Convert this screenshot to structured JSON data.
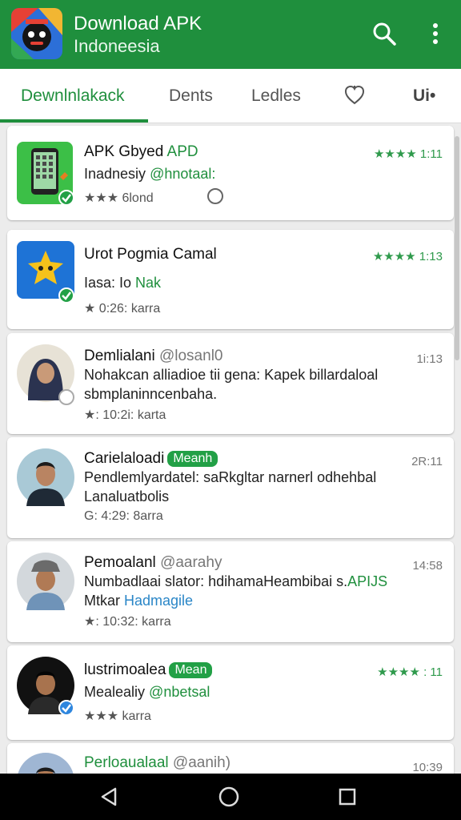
{
  "app": {
    "title": "Download APK",
    "subtitle": "Indoneesia"
  },
  "tabs": [
    {
      "label": "Dewnlnlakack"
    },
    {
      "label": "Dents"
    },
    {
      "label": "Ledles"
    },
    {
      "label": "heart-icon"
    },
    {
      "label": "Ui•"
    }
  ],
  "items": [
    {
      "title": "APK Gbyed ",
      "title_accent": "APD",
      "right": "★★★★ 1:11",
      "line2": "Inadnesiy ",
      "line2_accent": "@hnotaal:",
      "meta": "★★★ 6lond"
    },
    {
      "title": "Urot Pogmia Camal",
      "right": "★★★★ 1:13",
      "line2": "Iasa: Io ",
      "line2_accent": "Nak",
      "meta": "★ 0:26: karra"
    },
    {
      "title": "Demlialani ",
      "title_muted": "@losanl0",
      "right": "1i:13",
      "line2": "Nohakcan alliadioe tii gena: Kapek billardaloal",
      "line3": "sbmplaninncenbaha.",
      "meta": "★: 10:2i: karta"
    },
    {
      "title": "Carielaloadi",
      "badge": "Meanh",
      "right": "2R:11",
      "line2": "Pendlemlyardatel: saRkgltar narnerl odhehbal",
      "line3": "Lanaluatbolis",
      "meta": "G: 4:29: 8arra"
    },
    {
      "title": "Pemoalanl ",
      "title_muted": "@aarahy",
      "right": "14:58",
      "line2": "Numbadlaai slator: hdihamaHeambibai s.",
      "line2_accent": "APIJS",
      "line3": "Mtkar ",
      "line3_accent": "Hadmagile",
      "meta": "★: 10:32: karra"
    },
    {
      "title": "lustrimoalea",
      "badge": "Mean",
      "right": "★★★★ : 11",
      "line2": "Mealealiy ",
      "line2_accent": "@nbetsal",
      "meta": "★★★ karra"
    },
    {
      "title": "Perloaualaal ",
      "title_muted": "@aanih)",
      "right": "10:39"
    }
  ],
  "colors": {
    "primary": "#1f8f3d",
    "accent": "#22a046",
    "background": "#ececec"
  },
  "icons": {
    "search": "search-icon",
    "more": "more-vert-icon",
    "back": "nav-back-icon",
    "home": "nav-home-icon",
    "recents": "nav-recents-icon"
  }
}
